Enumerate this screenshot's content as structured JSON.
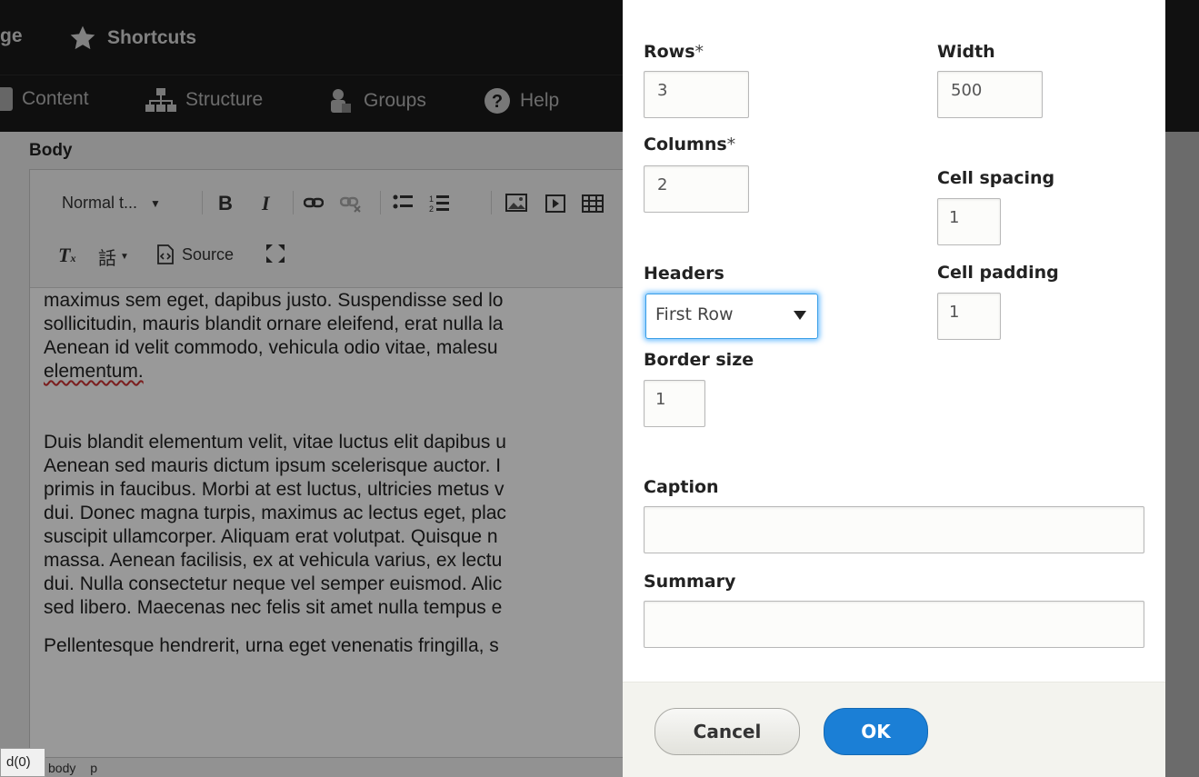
{
  "admin_toolbar": {
    "manage_partial": "ge",
    "shortcuts": "Shortcuts",
    "tray": [
      "Content",
      "Structure",
      "Groups",
      "Help"
    ]
  },
  "editor": {
    "field_label": "Body",
    "format_select": "Normal t...",
    "source_label": "Source",
    "paragraphs": [
      [
        "maximus sem eget, dapibus justo. Suspendisse sed lo",
        "sollicitudin, mauris blandit ornare eleifend, erat nulla la",
        "Aenean id velit commodo, vehicula odio vitae, malesu",
        "elementum."
      ],
      [
        "Duis blandit elementum velit, vitae luctus elit dapibus u",
        "Aenean sed mauris dictum ipsum scelerisque auctor. I",
        "primis in faucibus. Morbi at est luctus, ultricies metus v",
        "dui. Donec magna turpis, maximus ac lectus eget, plac",
        "suscipit ullamcorper. Aliquam erat volutpat. Quisque n",
        "massa. Aenean facilisis, ex at vehicula varius, ex lectu",
        "dui. Nulla consectetur neque vel semper euismod. Alic",
        "sed libero. Maecenas nec felis sit amet nulla tempus e"
      ],
      [
        "Pellentesque hendrerit, urna eget venenatis fringilla, s"
      ]
    ],
    "status_path": [
      "body",
      "p"
    ],
    "tooltip": "d(0)"
  },
  "dialog": {
    "rows_label": "Rows",
    "rows_value": "3",
    "columns_label": "Columns",
    "columns_value": "2",
    "required_mark": "*",
    "width_label": "Width",
    "width_value": "500",
    "cell_spacing_label": "Cell spacing",
    "cell_spacing_value": "1",
    "cell_padding_label": "Cell padding",
    "cell_padding_value": "1",
    "headers_label": "Headers",
    "headers_value": "First Row",
    "border_size_label": "Border size",
    "border_size_value": "1",
    "caption_label": "Caption",
    "caption_value": "",
    "summary_label": "Summary",
    "summary_value": "",
    "cancel_label": "Cancel",
    "ok_label": "OK"
  },
  "colors": {
    "ok_button": "#1b7fd6",
    "focus_glow": "#40aaff",
    "toolbar_bg": "#1a1a1a",
    "spellcheck": "#cc3333"
  }
}
